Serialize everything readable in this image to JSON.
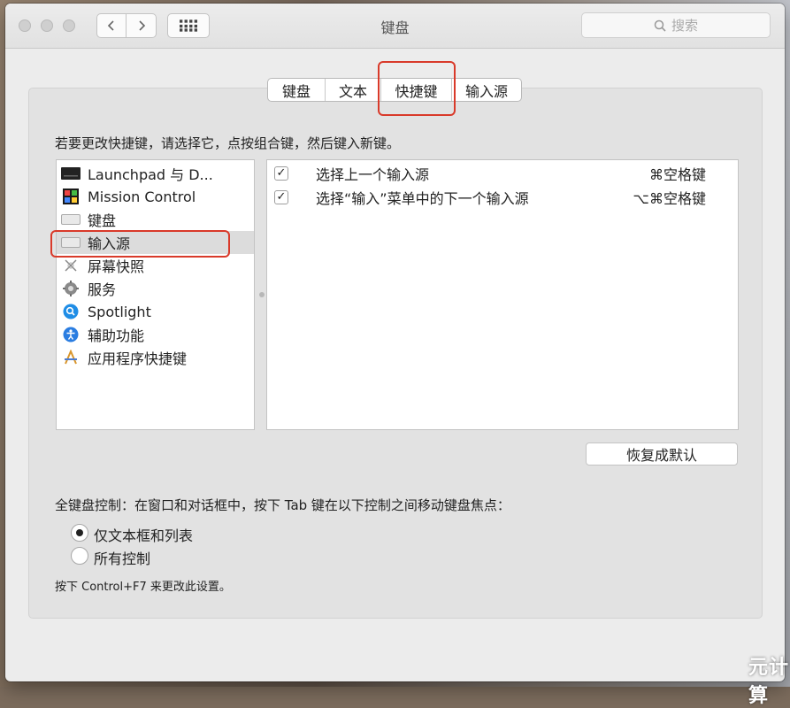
{
  "window": {
    "title": "键盘"
  },
  "search": {
    "placeholder": "搜索"
  },
  "tabs": [
    {
      "label": "键盘"
    },
    {
      "label": "文本"
    },
    {
      "label": "快捷键"
    },
    {
      "label": "输入源"
    }
  ],
  "instruction": "若要更改快捷键，请选择它，点按组合键，然后键入新键。",
  "categories": [
    {
      "label": "Launchpad 与 D...",
      "icon": "launchpad-icon"
    },
    {
      "label": "Mission Control",
      "icon": "mission-control-icon"
    },
    {
      "label": "键盘",
      "icon": "keyboard-icon"
    },
    {
      "label": "输入源",
      "icon": "input-source-icon",
      "selected": true
    },
    {
      "label": "屏幕快照",
      "icon": "screenshot-icon"
    },
    {
      "label": "服务",
      "icon": "gear-icon"
    },
    {
      "label": "Spotlight",
      "icon": "spotlight-icon"
    },
    {
      "label": "辅助功能",
      "icon": "accessibility-icon"
    },
    {
      "label": "应用程序快捷键",
      "icon": "app-shortcuts-icon"
    }
  ],
  "shortcuts": [
    {
      "checked": true,
      "label": "选择上一个输入源",
      "key": "⌘空格键"
    },
    {
      "checked": true,
      "label": "选择“输入”菜单中的下一个输入源",
      "key": "⌥⌘空格键"
    }
  ],
  "restore_label": "恢复成默认",
  "keyboard_control": {
    "title": "全键盘控制：在窗口和对话框中，按下 Tab 键在以下控制之间移动键盘焦点：",
    "options": [
      {
        "label": "仅文本框和列表",
        "selected": true
      },
      {
        "label": "所有控制",
        "selected": false
      }
    ],
    "note": "按下 Control+F7 来更改此设置。"
  },
  "watermark": "元计算",
  "colors": {
    "highlight_border": "#d93a2a",
    "selection": "#dcdcdc"
  }
}
